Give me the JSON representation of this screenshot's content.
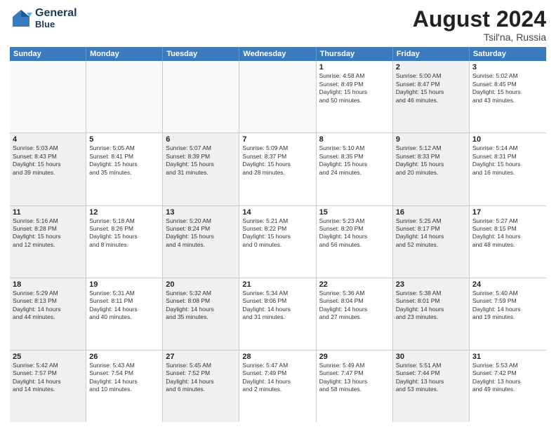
{
  "header": {
    "logo_line1": "General",
    "logo_line2": "Blue",
    "month_year": "August 2024",
    "location": "Tsil'na, Russia"
  },
  "days_of_week": [
    "Sunday",
    "Monday",
    "Tuesday",
    "Wednesday",
    "Thursday",
    "Friday",
    "Saturday"
  ],
  "rows": [
    [
      {
        "num": "",
        "text": "",
        "empty": true
      },
      {
        "num": "",
        "text": "",
        "empty": true
      },
      {
        "num": "",
        "text": "",
        "empty": true
      },
      {
        "num": "",
        "text": "",
        "empty": true
      },
      {
        "num": "1",
        "text": "Sunrise: 4:58 AM\nSunset: 8:49 PM\nDaylight: 15 hours\nand 50 minutes.",
        "shaded": false
      },
      {
        "num": "2",
        "text": "Sunrise: 5:00 AM\nSunset: 8:47 PM\nDaylight: 15 hours\nand 46 minutes.",
        "shaded": true
      },
      {
        "num": "3",
        "text": "Sunrise: 5:02 AM\nSunset: 8:45 PM\nDaylight: 15 hours\nand 43 minutes.",
        "shaded": false
      }
    ],
    [
      {
        "num": "4",
        "text": "Sunrise: 5:03 AM\nSunset: 8:43 PM\nDaylight: 15 hours\nand 39 minutes.",
        "shaded": true
      },
      {
        "num": "5",
        "text": "Sunrise: 5:05 AM\nSunset: 8:41 PM\nDaylight: 15 hours\nand 35 minutes.",
        "shaded": false
      },
      {
        "num": "6",
        "text": "Sunrise: 5:07 AM\nSunset: 8:39 PM\nDaylight: 15 hours\nand 31 minutes.",
        "shaded": true
      },
      {
        "num": "7",
        "text": "Sunrise: 5:09 AM\nSunset: 8:37 PM\nDaylight: 15 hours\nand 28 minutes.",
        "shaded": false
      },
      {
        "num": "8",
        "text": "Sunrise: 5:10 AM\nSunset: 8:35 PM\nDaylight: 15 hours\nand 24 minutes.",
        "shaded": false
      },
      {
        "num": "9",
        "text": "Sunrise: 5:12 AM\nSunset: 8:33 PM\nDaylight: 15 hours\nand 20 minutes.",
        "shaded": true
      },
      {
        "num": "10",
        "text": "Sunrise: 5:14 AM\nSunset: 8:31 PM\nDaylight: 15 hours\nand 16 minutes.",
        "shaded": false
      }
    ],
    [
      {
        "num": "11",
        "text": "Sunrise: 5:16 AM\nSunset: 8:28 PM\nDaylight: 15 hours\nand 12 minutes.",
        "shaded": true
      },
      {
        "num": "12",
        "text": "Sunrise: 5:18 AM\nSunset: 8:26 PM\nDaylight: 15 hours\nand 8 minutes.",
        "shaded": false
      },
      {
        "num": "13",
        "text": "Sunrise: 5:20 AM\nSunset: 8:24 PM\nDaylight: 15 hours\nand 4 minutes.",
        "shaded": true
      },
      {
        "num": "14",
        "text": "Sunrise: 5:21 AM\nSunset: 8:22 PM\nDaylight: 15 hours\nand 0 minutes.",
        "shaded": false
      },
      {
        "num": "15",
        "text": "Sunrise: 5:23 AM\nSunset: 8:20 PM\nDaylight: 14 hours\nand 56 minutes.",
        "shaded": false
      },
      {
        "num": "16",
        "text": "Sunrise: 5:25 AM\nSunset: 8:17 PM\nDaylight: 14 hours\nand 52 minutes.",
        "shaded": true
      },
      {
        "num": "17",
        "text": "Sunrise: 5:27 AM\nSunset: 8:15 PM\nDaylight: 14 hours\nand 48 minutes.",
        "shaded": false
      }
    ],
    [
      {
        "num": "18",
        "text": "Sunrise: 5:29 AM\nSunset: 8:13 PM\nDaylight: 14 hours\nand 44 minutes.",
        "shaded": true
      },
      {
        "num": "19",
        "text": "Sunrise: 5:31 AM\nSunset: 8:11 PM\nDaylight: 14 hours\nand 40 minutes.",
        "shaded": false
      },
      {
        "num": "20",
        "text": "Sunrise: 5:32 AM\nSunset: 8:08 PM\nDaylight: 14 hours\nand 35 minutes.",
        "shaded": true
      },
      {
        "num": "21",
        "text": "Sunrise: 5:34 AM\nSunset: 8:06 PM\nDaylight: 14 hours\nand 31 minutes.",
        "shaded": false
      },
      {
        "num": "22",
        "text": "Sunrise: 5:36 AM\nSunset: 8:04 PM\nDaylight: 14 hours\nand 27 minutes.",
        "shaded": false
      },
      {
        "num": "23",
        "text": "Sunrise: 5:38 AM\nSunset: 8:01 PM\nDaylight: 14 hours\nand 23 minutes.",
        "shaded": true
      },
      {
        "num": "24",
        "text": "Sunrise: 5:40 AM\nSunset: 7:59 PM\nDaylight: 14 hours\nand 19 minutes.",
        "shaded": false
      }
    ],
    [
      {
        "num": "25",
        "text": "Sunrise: 5:42 AM\nSunset: 7:57 PM\nDaylight: 14 hours\nand 14 minutes.",
        "shaded": true
      },
      {
        "num": "26",
        "text": "Sunrise: 5:43 AM\nSunset: 7:54 PM\nDaylight: 14 hours\nand 10 minutes.",
        "shaded": false
      },
      {
        "num": "27",
        "text": "Sunrise: 5:45 AM\nSunset: 7:52 PM\nDaylight: 14 hours\nand 6 minutes.",
        "shaded": true
      },
      {
        "num": "28",
        "text": "Sunrise: 5:47 AM\nSunset: 7:49 PM\nDaylight: 14 hours\nand 2 minutes.",
        "shaded": false
      },
      {
        "num": "29",
        "text": "Sunrise: 5:49 AM\nSunset: 7:47 PM\nDaylight: 13 hours\nand 58 minutes.",
        "shaded": false
      },
      {
        "num": "30",
        "text": "Sunrise: 5:51 AM\nSunset: 7:44 PM\nDaylight: 13 hours\nand 53 minutes.",
        "shaded": true
      },
      {
        "num": "31",
        "text": "Sunrise: 5:53 AM\nSunset: 7:42 PM\nDaylight: 13 hours\nand 49 minutes.",
        "shaded": false
      }
    ]
  ]
}
